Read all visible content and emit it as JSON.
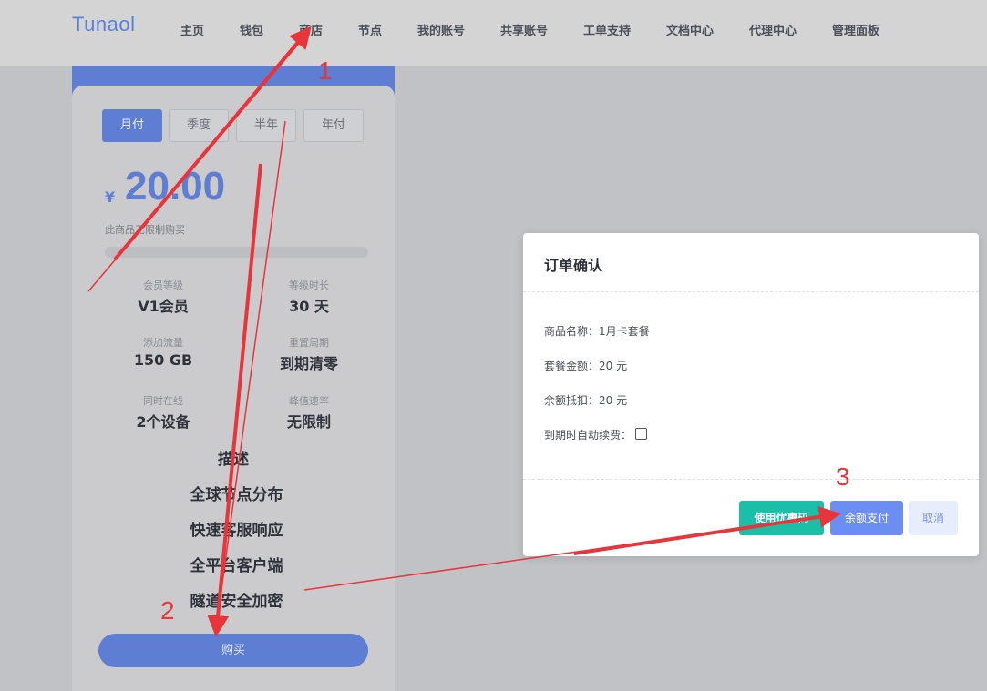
{
  "header": {
    "logo": "Tunaol",
    "nav": [
      "主页",
      "钱包",
      "商店",
      "节点",
      "我的账号",
      "共享账号",
      "工单支持",
      "文档中心",
      "代理中心",
      "管理面板"
    ]
  },
  "plan": {
    "periods": [
      "月付",
      "季度",
      "半年",
      "年付"
    ],
    "active_period": "月付",
    "currency": "¥",
    "price": "20.00",
    "limit_note": "此商品无限制购买",
    "progress_fraction": 0,
    "specs": [
      {
        "label": "会员等级",
        "value": "V1会员"
      },
      {
        "label": "等级时长",
        "value": "30 天"
      },
      {
        "label": "添加流量",
        "value": "150 GB"
      },
      {
        "label": "重置周期",
        "value": "到期清零"
      },
      {
        "label": "同时在线",
        "value": "2个设备"
      },
      {
        "label": "峰值速率",
        "value": "无限制"
      }
    ],
    "description_title": "描述",
    "features": [
      "全球节点分布",
      "快速客服响应",
      "全平台客户端",
      "隧道安全加密"
    ],
    "buy_label": "购买"
  },
  "modal": {
    "title": "订单确认",
    "product_label": "商品名称：",
    "product_value": "1月卡套餐",
    "amount_label": "套餐金额：",
    "amount_value": "20 元",
    "deduct_label": "余额抵扣：",
    "deduct_value": "20 元",
    "auto_renew_label": "到期时自动续费：",
    "auto_renew_checked": false,
    "coupon_button": "使用优惠码",
    "balance_button": "余额支付",
    "cancel_button": "取消"
  },
  "annotations": {
    "steps": [
      "1",
      "2",
      "3"
    ],
    "color": "#e8343b"
  },
  "colors": {
    "accent": "#5e7ed3",
    "teal": "#1bbfa8",
    "primary_button": "#6c8ef2"
  }
}
